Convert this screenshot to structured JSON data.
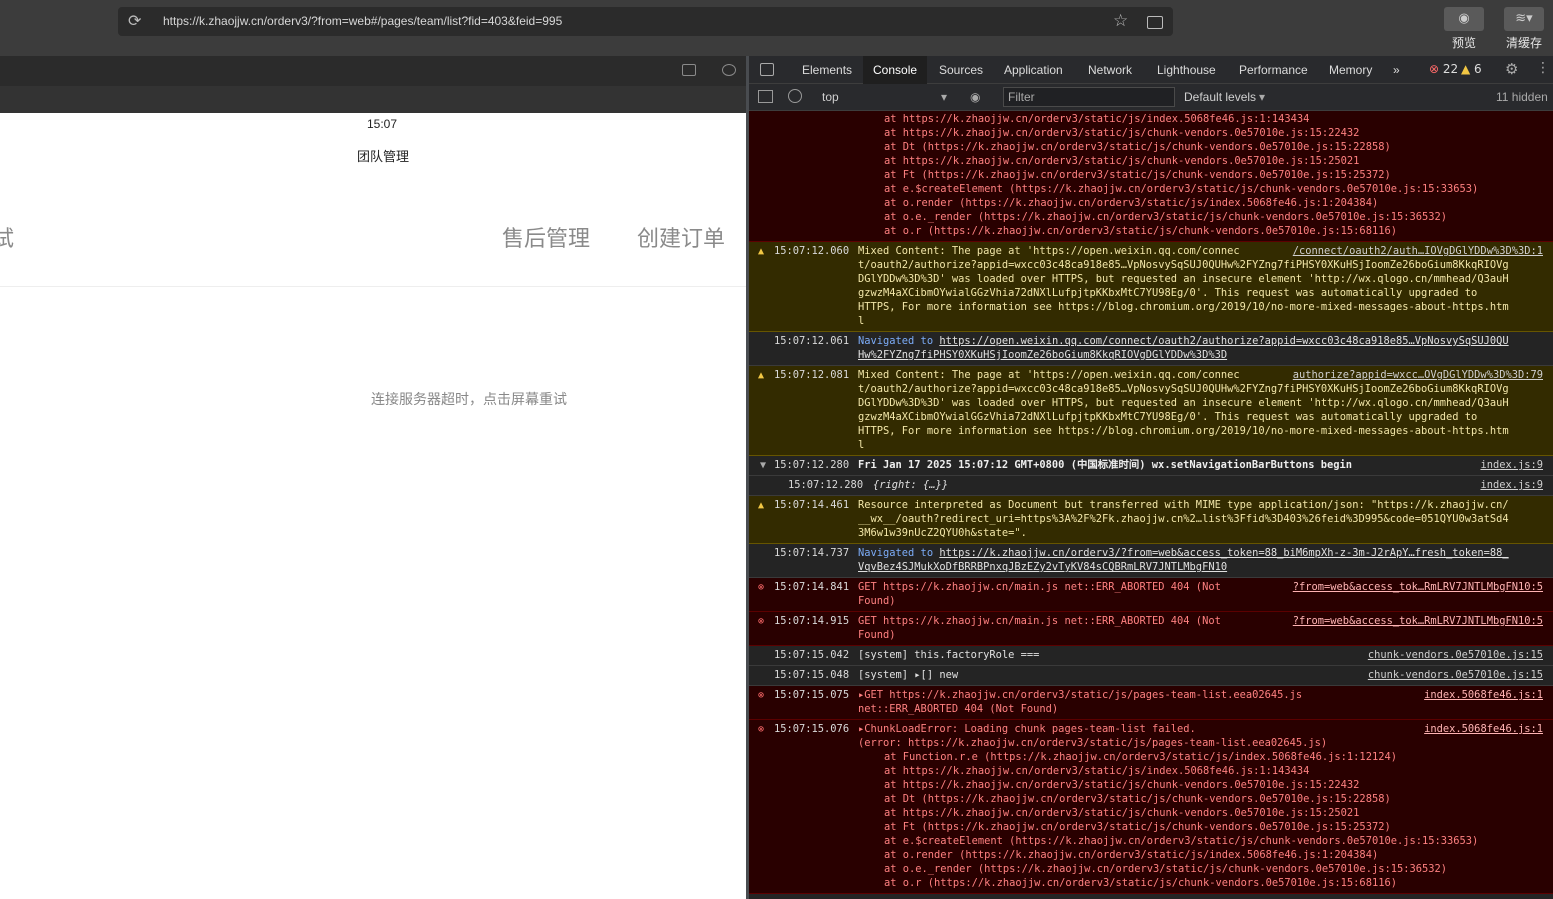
{
  "browser": {
    "url": "https://k.zhaojjw.cn/orderv3/?from=web#/pages/team/list?fid=403&feid=995",
    "preview_label": "预览",
    "clear_cache_label": "清缓存"
  },
  "simulator": {
    "time": "15:07",
    "page_title": "团队管理",
    "tab_partial": "试",
    "tab_after_sale": "售后管理",
    "tab_create_order": "创建订单",
    "error_message": "连接服务器超时，点击屏幕重试"
  },
  "devtools": {
    "tabs": [
      "Elements",
      "Console",
      "Sources",
      "Application",
      "Network",
      "Lighthouse",
      "Performance",
      "Memory"
    ],
    "more": "»",
    "error_count": "22",
    "warning_count": "6",
    "context": "top",
    "filter_placeholder": "Filter",
    "levels": "Default levels",
    "hidden": "11 hidden"
  },
  "console": {
    "top_stack": [
      "at https://k.zhaojjw.cn/orderv3/static/js/index.5068fe46.js:1:143434",
      "at https://k.zhaojjw.cn/orderv3/static/js/chunk-vendors.0e57010e.js:15:22432",
      "at Dt (https://k.zhaojjw.cn/orderv3/static/js/chunk-vendors.0e57010e.js:15:22858)",
      "at https://k.zhaojjw.cn/orderv3/static/js/chunk-vendors.0e57010e.js:15:25021",
      "at Ft (https://k.zhaojjw.cn/orderv3/static/js/chunk-vendors.0e57010e.js:15:25372)",
      "at e.$createElement (https://k.zhaojjw.cn/orderv3/static/js/chunk-vendors.0e57010e.js:15:33653)",
      "at o.render (https://k.zhaojjw.cn/orderv3/static/js/index.5068fe46.js:1:204384)",
      "at o.e._render (https://k.zhaojjw.cn/orderv3/static/js/chunk-vendors.0e57010e.js:15:36532)",
      "at o.r (https://k.zhaojjw.cn/orderv3/static/js/chunk-vendors.0e57010e.js:15:68116)"
    ],
    "m1_ts": "15:07:12.060",
    "m1_src": "/connect/oauth2/auth…IOVgDGlYDDw%3D%3D:1",
    "m1_l1": "Mixed Content: The page at 'https://open.weixin.qq.com/connec",
    "m1_l2": "t/oauth2/authorize?appid=wxcc03c48ca918e85…VpNosvySqSUJ0QUHw%2FYZng7fiPHSY0XKuHSjIoomZe26boGium8KkqRIOVg",
    "m1_l3": "DGlYDDw%3D%3D' was loaded over HTTPS, but requested an insecure element 'http://wx.qlogo.cn/mmhead/Q3auH",
    "m1_l4": "gzwzM4aXCibmOYwialGGzVhia72dNXlLufpjtpKKbxMtC7YU98Eg/0'. This request was automatically upgraded to",
    "m1_l5": "HTTPS, For more information see https://blog.chromium.org/2019/10/no-more-mixed-messages-about-https.htm",
    "m1_l6": "l",
    "m2_ts": "15:07:12.061",
    "m2_nav": "Navigated to",
    "m2_l1": "https://open.weixin.qq.com/connect/oauth2/authorize?appid=wxcc03c48ca918e85…VpNosvySqSUJ0QU",
    "m2_l2": "Hw%2FYZng7fiPHSY0XKuHSjIoomZe26boGium8KkqRIOVgDGlYDDw%3D%3D",
    "m3_ts": "15:07:12.081",
    "m3_src": "authorize?appid=wxcc…OVgDGlYDDw%3D%3D:79",
    "m3_l1": "Mixed Content: The page at 'https://open.weixin.qq.com/connec",
    "m3_l2": "t/oauth2/authorize?appid=wxcc03c48ca918e85…VpNosvySqSUJ0QUHw%2FYZng7fiPHSY0XKuHSjIoomZe26boGium8KkqRIOVg",
    "m3_l3": "DGlYDDw%3D%3D' was loaded over HTTPS, but requested an insecure element 'http://wx.qlogo.cn/mmhead/Q3auH",
    "m3_l4": "gzwzM4aXCibmOYwialGGzVhia72dNXlLufpjtpKKbxMtC7YU98Eg/0'. This request was automatically upgraded to",
    "m3_l5": "HTTPS, For more information see https://blog.chromium.org/2019/10/no-more-mixed-messages-about-https.htm",
    "m3_l6": "l",
    "m4_ts": "15:07:12.280",
    "m4_text": "Fri Jan 17 2025 15:07:12 GMT+0800 (中国标准时间) wx.setNavigationBarButtons begin",
    "m4_src": "index.js:9",
    "m5_ts": "15:07:12.280",
    "m5_text": "{right: {…}}",
    "m5_src": "index.js:9",
    "m6_ts": "15:07:14.461",
    "m6_l1": "Resource interpreted as Document but transferred with MIME type application/json: \"https://k.zhaojjw.cn/",
    "m6_l2": "__wx__/oauth?redirect_uri=https%3A%2F%2Fk.zhaojjw.cn%2…list%3Ffid%3D403%26feid%3D995&code=051QYU0w3atSd4",
    "m6_l3": "3M6w1w39nUcZ2QYU0h&state=\".",
    "m7_ts": "15:07:14.737",
    "m7_nav": "Navigated to",
    "m7_l1": "https://k.zhaojjw.cn/orderv3/?from=web&access_token=88_biM6mpXh-z-3m-J2rApY…fresh_token=88_",
    "m7_l2": "VqvBez4SJMukXoDfBRRBPnxqJBzEZy2vTyKV84sCQBRmLRV7JNTLMbgFN10",
    "m8_ts": "15:07:14.841",
    "m8_l1": "GET https://k.zhaojjw.cn/main.js net::ERR_ABORTED 404 (Not",
    "m8_l2": "Found)",
    "m8_src": "?from=web&access_tok…RmLRV7JNTLMbgFN10:5",
    "m9_ts": "15:07:14.915",
    "m9_l1": "GET https://k.zhaojjw.cn/main.js net::ERR_ABORTED 404 (Not",
    "m9_l2": "Found)",
    "m9_src": "?from=web&access_tok…RmLRV7JNTLMbgFN10:5",
    "m10_ts": "15:07:15.042",
    "m10_text": "[system]  this.factoryRole ===",
    "m10_src": "chunk-vendors.0e57010e.js:15",
    "m11_ts": "15:07:15.048",
    "m11_text": "[system] ▸[] new",
    "m11_src": "chunk-vendors.0e57010e.js:15",
    "m12_ts": "15:07:15.075",
    "m12_l1": "▸GET https://k.zhaojjw.cn/orderv3/static/js/pages-team-list.eea02645.js",
    "m12_l2": "net::ERR_ABORTED 404 (Not Found)",
    "m12_src": "index.5068fe46.js:1",
    "m13_ts": "15:07:15.076",
    "m13_l1": "▸ChunkLoadError: Loading chunk pages-team-list failed.",
    "m13_l2": "(error: https://k.zhaojjw.cn/orderv3/static/js/pages-team-list.eea02645.js)",
    "m13_src": "index.5068fe46.js:1",
    "bottom_stack": [
      "at Function.r.e (https://k.zhaojjw.cn/orderv3/static/js/index.5068fe46.js:1:12124)",
      "at https://k.zhaojjw.cn/orderv3/static/js/index.5068fe46.js:1:143434",
      "at https://k.zhaojjw.cn/orderv3/static/js/chunk-vendors.0e57010e.js:15:22432",
      "at Dt (https://k.zhaojjw.cn/orderv3/static/js/chunk-vendors.0e57010e.js:15:22858)",
      "at https://k.zhaojjw.cn/orderv3/static/js/chunk-vendors.0e57010e.js:15:25021",
      "at Ft (https://k.zhaojjw.cn/orderv3/static/js/chunk-vendors.0e57010e.js:15:25372)",
      "at e.$createElement (https://k.zhaojjw.cn/orderv3/static/js/chunk-vendors.0e57010e.js:15:33653)",
      "at o.render (https://k.zhaojjw.cn/orderv3/static/js/index.5068fe46.js:1:204384)",
      "at o.e._render (https://k.zhaojjw.cn/orderv3/static/js/chunk-vendors.0e57010e.js:15:36532)",
      "at o.r (https://k.zhaojjw.cn/orderv3/static/js/chunk-vendors.0e57010e.js:15:68116)"
    ]
  },
  "icons": {
    "reload": "reload-icon",
    "star": "star-icon",
    "folder": "folder-icon",
    "eye": "eye-icon",
    "layers": "layers-icon",
    "inspect": "inspect-icon",
    "settings": "gear-icon"
  },
  "colors": {
    "error_bg": "#290000",
    "error_text": "#ff8080",
    "warning_bg": "#332b00",
    "warning_text": "#f2e6a8",
    "link_blue": "#7cacf8"
  }
}
